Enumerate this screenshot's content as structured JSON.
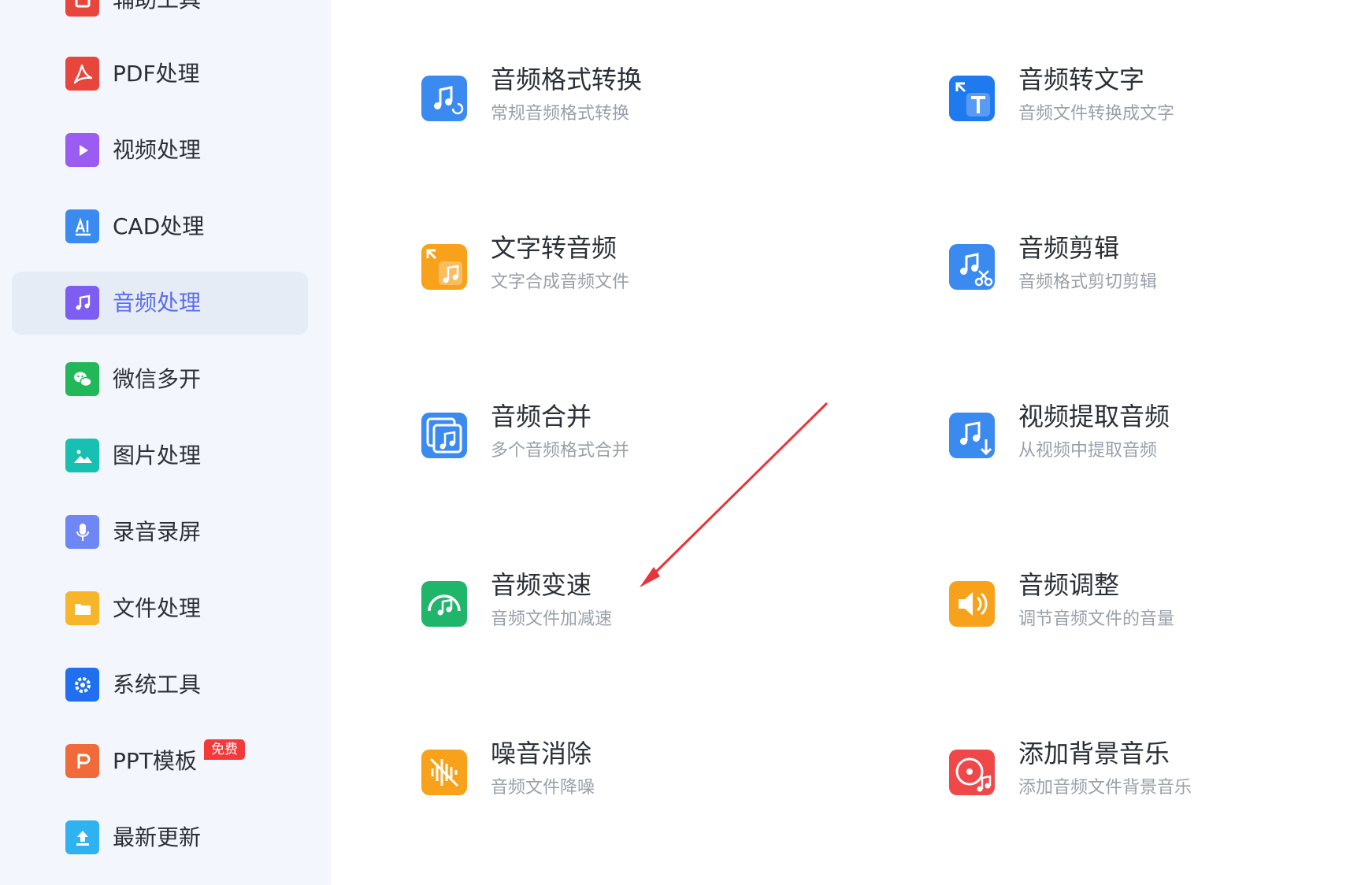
{
  "sidebar": {
    "items": [
      {
        "label": "辅助工具",
        "icon": "helper-icon",
        "color": "#e8453c",
        "active": false
      },
      {
        "label": "PDF处理",
        "icon": "pdf-icon",
        "color": "#e8453c",
        "active": false
      },
      {
        "label": "视频处理",
        "icon": "video-play-icon",
        "color": "#9b5cf2",
        "active": false
      },
      {
        "label": "CAD处理",
        "icon": "cad-icon",
        "color": "#3a8af0",
        "active": false
      },
      {
        "label": "音频处理",
        "icon": "music-note-icon",
        "color": "#7e5ef2",
        "active": true
      },
      {
        "label": "微信多开",
        "icon": "wechat-icon",
        "color": "#22b85a",
        "active": false
      },
      {
        "label": "图片处理",
        "icon": "image-icon",
        "color": "#17c0b0",
        "active": false
      },
      {
        "label": "录音录屏",
        "icon": "microphone-icon",
        "color": "#6f86f5",
        "active": false
      },
      {
        "label": "文件处理",
        "icon": "folder-icon",
        "color": "#f7b52a",
        "active": false
      },
      {
        "label": "系统工具",
        "icon": "gear-icon",
        "color": "#1f6ff0",
        "active": false
      },
      {
        "label": "PPT模板",
        "icon": "ppt-icon",
        "color": "#f06a3a",
        "active": false,
        "badge": "免费"
      },
      {
        "label": "最新更新",
        "icon": "upload-icon",
        "color": "#2fb3f0",
        "active": false
      }
    ]
  },
  "tools": [
    {
      "title": "音频格式转换",
      "subtitle": "常规音频格式转换",
      "icon": "audio-convert-icon",
      "color": "#3a8af0"
    },
    {
      "title": "音频转文字",
      "subtitle": "音频文件转换成文字",
      "icon": "audio-to-text-icon",
      "color": "#1f7af0"
    },
    {
      "title": "文字转音频",
      "subtitle": "文字合成音频文件",
      "icon": "text-to-audio-icon",
      "color": "#f7a21a"
    },
    {
      "title": "音频剪辑",
      "subtitle": "音频格式剪切剪辑",
      "icon": "audio-cut-icon",
      "color": "#3a8af0"
    },
    {
      "title": "音频合并",
      "subtitle": "多个音频格式合并",
      "icon": "audio-merge-icon",
      "color": "#3a8af0"
    },
    {
      "title": "视频提取音频",
      "subtitle": "从视频中提取音频",
      "icon": "extract-audio-icon",
      "color": "#3a8af0"
    },
    {
      "title": "音频变速",
      "subtitle": "音频文件加减速",
      "icon": "audio-speed-icon",
      "color": "#1fb56a"
    },
    {
      "title": "音频调整",
      "subtitle": "调节音频文件的音量",
      "icon": "volume-icon",
      "color": "#f7a21a"
    },
    {
      "title": "噪音消除",
      "subtitle": "音频文件降噪",
      "icon": "noise-reduce-icon",
      "color": "#f7a21a"
    },
    {
      "title": "添加背景音乐",
      "subtitle": "添加音频文件背景音乐",
      "icon": "bg-music-icon",
      "color": "#f04848"
    }
  ],
  "annotation": {
    "arrow_color": "#e8343a"
  }
}
